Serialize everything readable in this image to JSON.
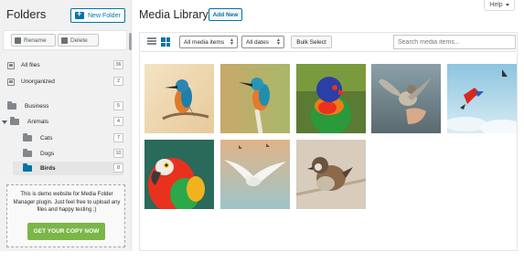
{
  "sidebar": {
    "title": "Folders",
    "new_folder_label": "New Folder",
    "rename_label": "Rename",
    "delete_label": "Delete",
    "items": [
      {
        "label": "All files",
        "count": "36",
        "icon": "file-icon"
      },
      {
        "label": "Unorganized",
        "count": "2",
        "icon": "file-icon"
      },
      {
        "label": "Business",
        "count": "5",
        "icon": "folder-icon"
      },
      {
        "label": "Animals",
        "count": "4",
        "icon": "folder-icon"
      },
      {
        "label": "Cats",
        "count": "7",
        "icon": "folder-icon"
      },
      {
        "label": "Dogs",
        "count": "10",
        "icon": "folder-icon"
      },
      {
        "label": "Birds",
        "count": "8",
        "icon": "folder-icon",
        "active": true
      }
    ],
    "demo_text": "This is demo website for Media Folder Manager plugin. Just feel free to upload any files and happy testing ;)",
    "cta_label": "GET YOUR COPY NOW"
  },
  "header": {
    "title": "Media Library",
    "add_new_label": "Add New",
    "help_label": "Help"
  },
  "toolbar": {
    "filter_type": "All media items",
    "filter_date": "All dates",
    "bulk_select_label": "Bulk Select",
    "search_placeholder": "Search media items..."
  },
  "gallery": {
    "items": [
      "kingfisher-1",
      "kingfisher-2",
      "rainbow-lorikeet",
      "sparrow-on-hand",
      "flying-parrots",
      "macaw",
      "seagull-flying",
      "sparrow-perched"
    ]
  },
  "colors": {
    "accent": "#0073aa",
    "cta": "#7ab648",
    "sidebar_bg": "#f1f1f1"
  }
}
